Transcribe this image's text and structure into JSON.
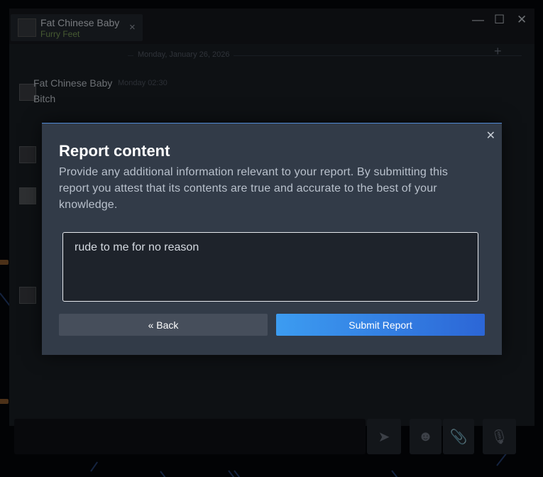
{
  "chat_window": {
    "tab": {
      "name": "Fat Chinese Baby",
      "status": "Furry Feet",
      "close_icon": "×"
    },
    "window_controls": {
      "minimize": "—",
      "maximize": "☐",
      "close": "✕"
    },
    "date_divider": "Monday, January 26, 2026",
    "message": {
      "sender": "Fat Chinese Baby",
      "time": "Monday 02:30",
      "text": "Bitch"
    },
    "composer": {
      "send_icon": "➤",
      "emoji_icon": "☻",
      "attach_icon": "📎",
      "voice_icon": "🎙"
    }
  },
  "dialog": {
    "title": "Report content",
    "description": "Provide any additional information relevant to your report. By submitting this report you attest that its contents are true and accurate to the best of your knowledge.",
    "field_value": "rude to me for no reason",
    "close_icon": "✕",
    "back_label": "« Back",
    "submit_label": "Submit Report"
  },
  "colors": {
    "dialog_bg": "#323b48",
    "accent_blue": "#3c9cf1",
    "accent_blue_dark": "#2c66d6",
    "back_button": "#464e5b",
    "status_green": "#7fa35a"
  }
}
